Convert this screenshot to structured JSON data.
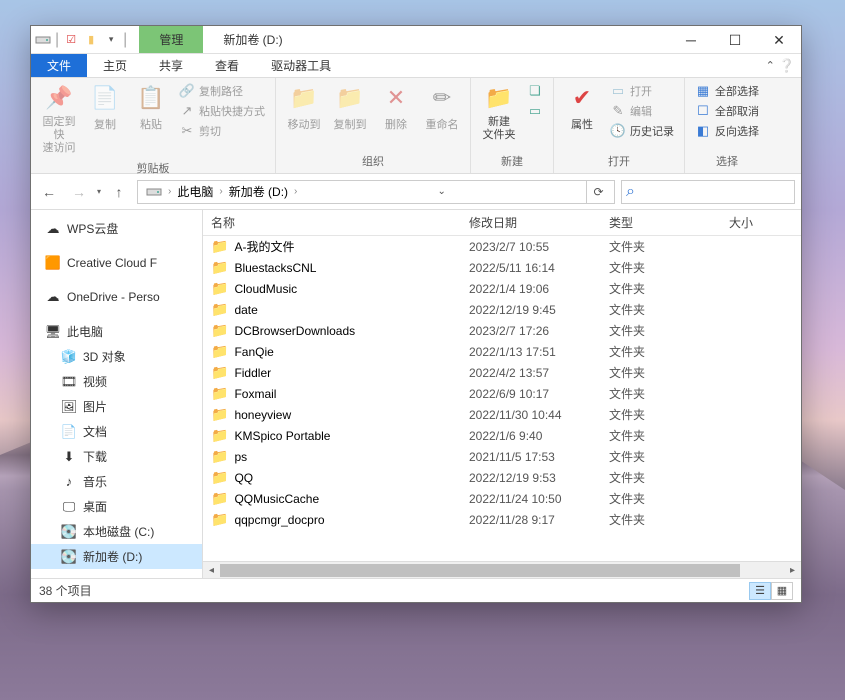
{
  "window": {
    "context_tab": "管理",
    "title": "新加卷 (D:)"
  },
  "menu": {
    "file": "文件",
    "home": "主页",
    "share": "共享",
    "view": "查看",
    "drive_tools": "驱动器工具"
  },
  "ribbon": {
    "pin": "固定到快\n速访问",
    "copy": "复制",
    "paste": "粘贴",
    "copy_path": "复制路径",
    "paste_shortcut": "粘贴快捷方式",
    "cut": "剪切",
    "group_clipboard": "剪贴板",
    "move_to": "移动到",
    "copy_to": "复制到",
    "delete": "删除",
    "rename": "重命名",
    "group_organize": "组织",
    "new_folder": "新建\n文件夹",
    "group_new": "新建",
    "properties": "属性",
    "open": "打开",
    "edit": "编辑",
    "history": "历史记录",
    "group_open": "打开",
    "select_all": "全部选择",
    "select_none": "全部取消",
    "invert_selection": "反向选择",
    "group_select": "选择"
  },
  "breadcrumb": {
    "this_pc": "此电脑",
    "drive": "新加卷 (D:)"
  },
  "search": {
    "placeholder": ""
  },
  "columns": {
    "name": "名称",
    "date": "修改日期",
    "type": "类型",
    "size": "大小"
  },
  "sidebar": [
    {
      "label": "WPS云盘",
      "icon": "cloud-blue",
      "level": 0
    },
    {
      "label": "Creative Cloud F",
      "icon": "cc",
      "level": 0
    },
    {
      "label": "OneDrive - Perso",
      "icon": "cloud-blue",
      "level": 0
    },
    {
      "label": "此电脑",
      "icon": "pc",
      "level": 0
    },
    {
      "label": "3D 对象",
      "icon": "3d",
      "level": 1
    },
    {
      "label": "视频",
      "icon": "video",
      "level": 1
    },
    {
      "label": "图片",
      "icon": "picture",
      "level": 1
    },
    {
      "label": "文档",
      "icon": "doc",
      "level": 1
    },
    {
      "label": "下载",
      "icon": "download",
      "level": 1
    },
    {
      "label": "音乐",
      "icon": "music",
      "level": 1
    },
    {
      "label": "桌面",
      "icon": "desktop",
      "level": 1
    },
    {
      "label": "本地磁盘 (C:)",
      "icon": "disk",
      "level": 1
    },
    {
      "label": "新加卷 (D:)",
      "icon": "disk",
      "level": 1,
      "active": true
    }
  ],
  "files": [
    {
      "name": "A-我的文件",
      "date": "2023/2/7 10:55",
      "type": "文件夹"
    },
    {
      "name": "BluestacksCNL",
      "date": "2022/5/11 16:14",
      "type": "文件夹"
    },
    {
      "name": "CloudMusic",
      "date": "2022/1/4 19:06",
      "type": "文件夹"
    },
    {
      "name": "date",
      "date": "2022/12/19 9:45",
      "type": "文件夹"
    },
    {
      "name": "DCBrowserDownloads",
      "date": "2023/2/7 17:26",
      "type": "文件夹"
    },
    {
      "name": "FanQie",
      "date": "2022/1/13 17:51",
      "type": "文件夹"
    },
    {
      "name": "Fiddler",
      "date": "2022/4/2 13:57",
      "type": "文件夹"
    },
    {
      "name": "Foxmail",
      "date": "2022/6/9 10:17",
      "type": "文件夹"
    },
    {
      "name": "honeyview",
      "date": "2022/11/30 10:44",
      "type": "文件夹"
    },
    {
      "name": "KMSpico Portable",
      "date": "2022/1/6 9:40",
      "type": "文件夹"
    },
    {
      "name": "ps",
      "date": "2021/11/5 17:53",
      "type": "文件夹"
    },
    {
      "name": "QQ",
      "date": "2022/12/19 9:53",
      "type": "文件夹"
    },
    {
      "name": "QQMusicCache",
      "date": "2022/11/24 10:50",
      "type": "文件夹"
    },
    {
      "name": "qqpcmgr_docpro",
      "date": "2022/11/28 9:17",
      "type": "文件夹"
    }
  ],
  "status": {
    "count": "38 个项目"
  }
}
